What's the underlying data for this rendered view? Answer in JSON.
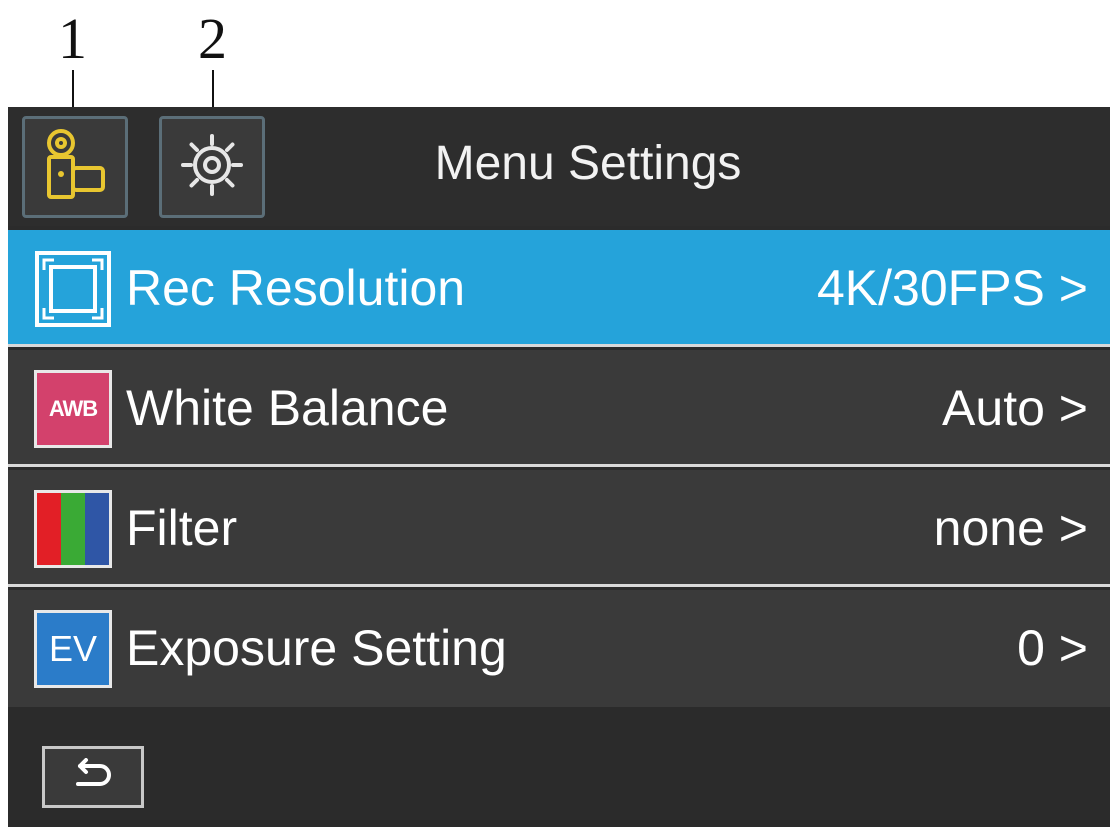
{
  "callouts": [
    {
      "label": "1"
    },
    {
      "label": "2"
    }
  ],
  "header": {
    "title": "Menu Settings",
    "tabs": [
      {
        "icon": "video-camera-icon",
        "color": "#e8c630",
        "active": true
      },
      {
        "icon": "gear-icon",
        "color": "#e6e6e6",
        "active": false
      }
    ]
  },
  "menu": {
    "items": [
      {
        "icon": "resolution-frame-icon",
        "label": "Rec Resolution",
        "value": "4K/30FPS >",
        "selected": true
      },
      {
        "icon": "white-balance-icon",
        "icon_text": "AWB",
        "label": "White Balance",
        "value": "Auto >",
        "selected": false
      },
      {
        "icon": "filter-rgb-icon",
        "label": "Filter",
        "value": "none >",
        "selected": false
      },
      {
        "icon": "exposure-ev-icon",
        "icon_text": "EV",
        "label": "Exposure Setting",
        "value": "0 >",
        "selected": false
      }
    ]
  },
  "footer": {
    "icon": "back-arrow-icon"
  },
  "colors": {
    "selected_row": "#25a3da",
    "row_background": "#3a3a3a",
    "header_background": "#2d2d2d",
    "awb_icon": "#d3416c",
    "ev_icon": "#2b7cc9",
    "filter_red": "#e21f26",
    "filter_green": "#3aaa35",
    "filter_blue": "#2f56a6",
    "camera_icon": "#e8c630"
  }
}
